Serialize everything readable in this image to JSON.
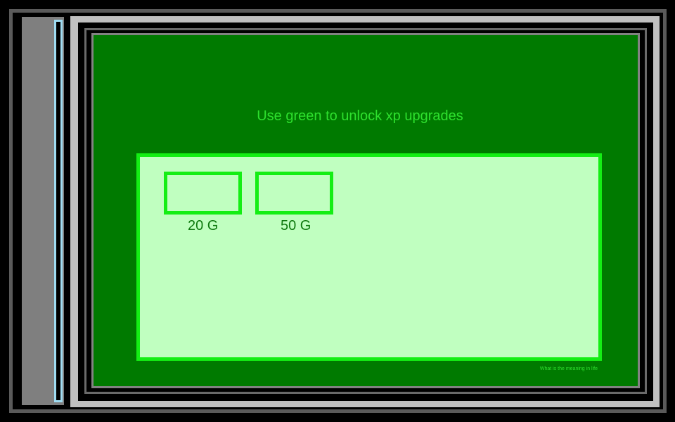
{
  "game": {
    "title": "Use green to unlock xp upgrades",
    "footer_text": "What is the meaning in life",
    "upgrades": [
      {
        "price": "20 G"
      },
      {
        "price": "50 G"
      }
    ]
  },
  "colors": {
    "background": "#000000",
    "frame": "#7f7f7f",
    "sidebar_accent": "#9fdcf2",
    "screen": "#007a00",
    "panel": "#c0ffc0",
    "accent_green": "#14ee14",
    "title_text": "#2ee02e",
    "price_text": "#0f7a0f"
  }
}
